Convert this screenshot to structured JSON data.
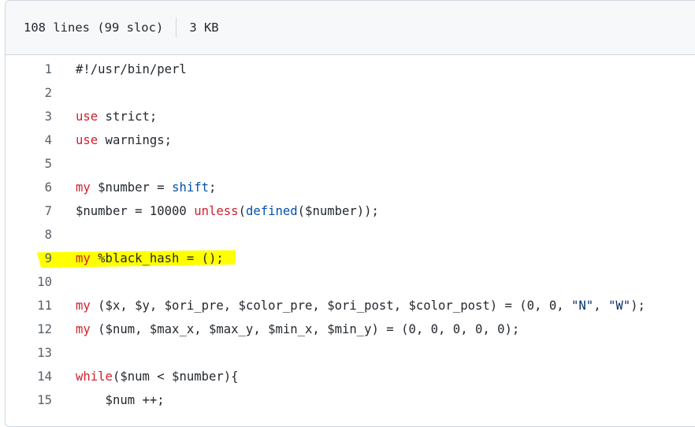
{
  "file_info": {
    "lines": "108 lines (99 sloc)",
    "size": "3 KB"
  },
  "highlight": {
    "line": "9",
    "color": "#ffff00"
  },
  "code_lines": [
    {
      "num": "1",
      "tokens": [
        {
          "t": "#!/usr/bin/perl",
          "c": ""
        }
      ]
    },
    {
      "num": "2",
      "tokens": []
    },
    {
      "num": "3",
      "tokens": [
        {
          "t": "use",
          "c": "kw"
        },
        {
          "t": " strict;",
          "c": ""
        }
      ]
    },
    {
      "num": "4",
      "tokens": [
        {
          "t": "use",
          "c": "kw"
        },
        {
          "t": " warnings;",
          "c": ""
        }
      ]
    },
    {
      "num": "5",
      "tokens": []
    },
    {
      "num": "6",
      "tokens": [
        {
          "t": "my",
          "c": "kw"
        },
        {
          "t": " $number = ",
          "c": ""
        },
        {
          "t": "shift",
          "c": "fn"
        },
        {
          "t": ";",
          "c": ""
        }
      ]
    },
    {
      "num": "7",
      "tokens": [
        {
          "t": "$number = 10000 ",
          "c": ""
        },
        {
          "t": "unless",
          "c": "kw"
        },
        {
          "t": "(",
          "c": ""
        },
        {
          "t": "defined",
          "c": "fn"
        },
        {
          "t": "($number));",
          "c": ""
        }
      ]
    },
    {
      "num": "8",
      "tokens": []
    },
    {
      "num": "9",
      "tokens": [
        {
          "t": "my",
          "c": "kw"
        },
        {
          "t": " %black_hash = ();",
          "c": ""
        }
      ]
    },
    {
      "num": "10",
      "tokens": []
    },
    {
      "num": "11",
      "tokens": [
        {
          "t": "my",
          "c": "kw"
        },
        {
          "t": " ($x, $y, $ori_pre, $color_pre, $ori_post, $color_post) = (0, 0, ",
          "c": ""
        },
        {
          "t": "\"N\"",
          "c": "str"
        },
        {
          "t": ", ",
          "c": ""
        },
        {
          "t": "\"W\"",
          "c": "str"
        },
        {
          "t": ");",
          "c": ""
        }
      ]
    },
    {
      "num": "12",
      "tokens": [
        {
          "t": "my",
          "c": "kw"
        },
        {
          "t": " ($num, $max_x, $max_y, $min_x, $min_y) = (0, 0, 0, 0, 0);",
          "c": ""
        }
      ]
    },
    {
      "num": "13",
      "tokens": []
    },
    {
      "num": "14",
      "tokens": [
        {
          "t": "while",
          "c": "kw"
        },
        {
          "t": "($num < $number){",
          "c": ""
        }
      ]
    },
    {
      "num": "15",
      "tokens": [
        {
          "t": "    $num ++;",
          "c": ""
        }
      ]
    }
  ]
}
